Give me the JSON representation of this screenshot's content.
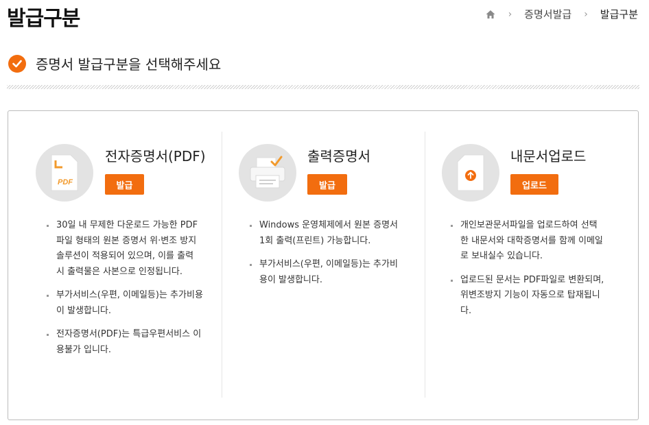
{
  "page": {
    "title": "발급구분"
  },
  "breadcrumb": {
    "home_label": "홈",
    "items": [
      "증명서발급",
      "발급구분"
    ]
  },
  "subtitle": "증명서 발급구분을 선택해주세요",
  "colors": {
    "accent": "#f26d0f",
    "icon_bg": "#e3e3e3"
  },
  "options": [
    {
      "title": "전자증명서(PDF)",
      "button_label": "발급",
      "icon": "pdf-document-icon",
      "icon_text": "PDF",
      "bullets": [
        "30일 내 무제한 다운로드 가능한 PDF 파일 형태의 원본 증명서 위·변조 방지 솔루션이 적용되어 있으며, 이를 출력 시 출력물은 사본으로 인정됩니다.",
        "부가서비스(우편, 이메일등)는 추가비용이 발생합니다.",
        "전자증명서(PDF)는 특급우편서비스 이용불가 입니다."
      ]
    },
    {
      "title": "출력증명서",
      "button_label": "발급",
      "icon": "printer-icon",
      "bullets": [
        "Windows 운영체제에서 원본 증명서 1회 출력(프린트) 가능합니다.",
        "부가서비스(우편, 이메일등)는 추가비용이 발생합니다."
      ]
    },
    {
      "title": "내문서업로드",
      "button_label": "업로드",
      "icon": "upload-document-icon",
      "bullets": [
        "개인보관문서파일을 업로드하여 선택한 내문서와 대학증명서를 함께 이메일로 보내실수 있습니다.",
        "업로드된 문서는 PDF파일로 변환되며, 위변조방지 기능이 자동으로 탑재됩니다."
      ]
    }
  ]
}
